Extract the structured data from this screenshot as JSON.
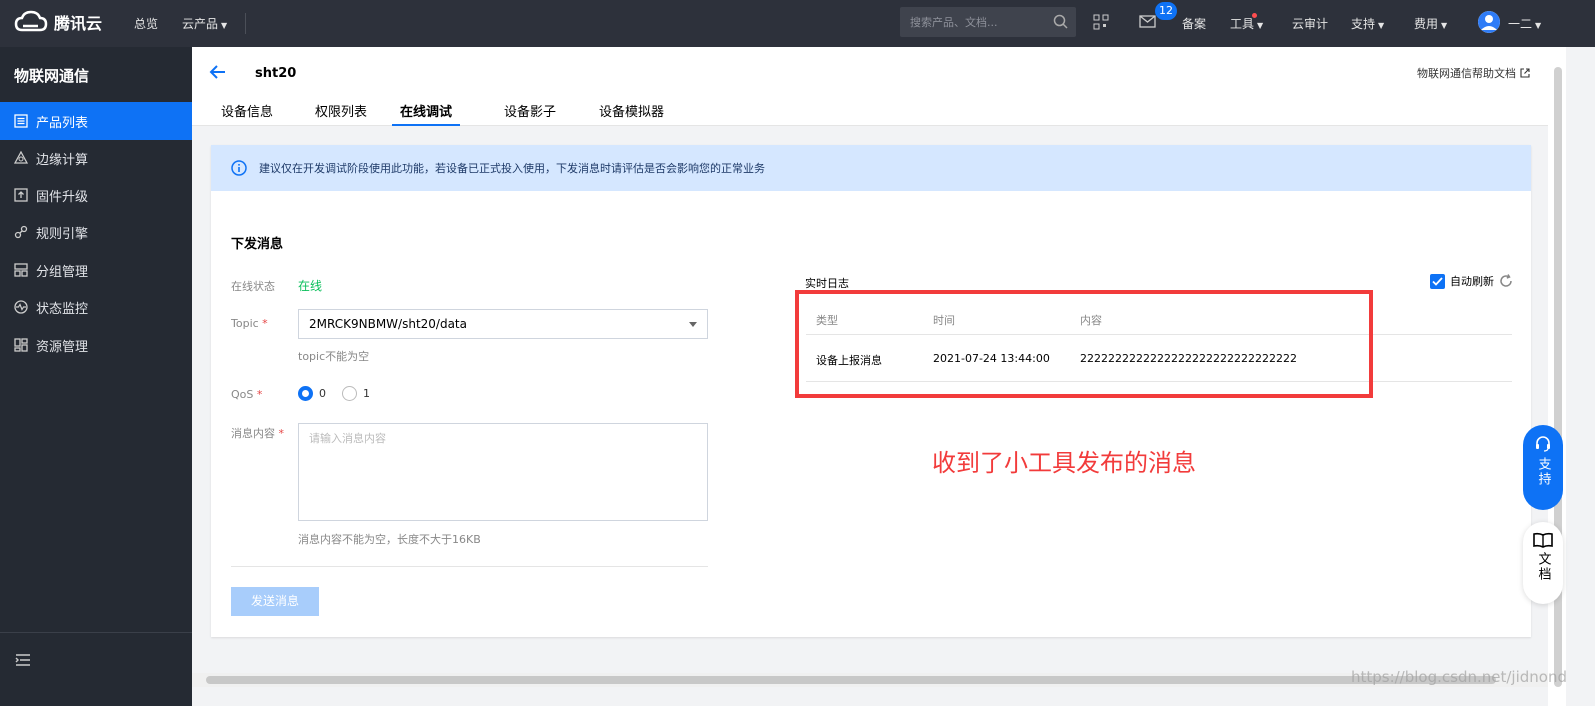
{
  "topbar": {
    "logo_text": "腾讯云",
    "nav_overview": "总览",
    "nav_products": "云产品",
    "search_placeholder": "搜索产品、文档...",
    "mail_badge": "12",
    "beian": "备案",
    "tools": "工具",
    "audit": "云审计",
    "support": "支持",
    "billing": "费用",
    "user": "一二"
  },
  "sidebar": {
    "title": "物联网通信",
    "items": [
      {
        "label": "产品列表",
        "icon": "list-icon"
      },
      {
        "label": "边缘计算",
        "icon": "edge-icon"
      },
      {
        "label": "固件升级",
        "icon": "upgrade-icon"
      },
      {
        "label": "规则引擎",
        "icon": "link-icon"
      },
      {
        "label": "分组管理",
        "icon": "group-icon"
      },
      {
        "label": "状态监控",
        "icon": "monitor-icon"
      },
      {
        "label": "资源管理",
        "icon": "resource-icon"
      }
    ]
  },
  "header": {
    "title": "sht20",
    "help_link": "物联网通信帮助文档",
    "tabs": [
      "设备信息",
      "权限列表",
      "在线调试",
      "设备影子",
      "设备模拟器"
    ],
    "active_tab": "在线调试"
  },
  "notice": "建议仅在开发调试阶段使用此功能，若设备已正式投入使用，下发消息时请评估是否会影响您的正常业务",
  "form": {
    "section_title": "下发消息",
    "status_label": "在线状态",
    "status_value": "在线",
    "topic_label": "Topic",
    "topic_value": "2MRCK9NBMW/sht20/data",
    "topic_hint": "topic不能为空",
    "qos_label": "QoS",
    "qos_options": [
      "0",
      "1"
    ],
    "qos_selected": "0",
    "content_label": "消息内容",
    "content_placeholder": "请输入消息内容",
    "content_hint": "消息内容不能为空，长度不大于16KB",
    "send_button": "发送消息",
    "required_mark": "*"
  },
  "log": {
    "title": "实时日志",
    "auto_refresh": "自动刷新",
    "auto_refresh_checked": true,
    "columns": [
      "类型",
      "时间",
      "内容"
    ],
    "rows": [
      {
        "type": "设备上报消息",
        "time": "2021-07-24 13:44:00",
        "content": "2222222222222222222222222222222"
      }
    ]
  },
  "annotation": "收到了小工具发布的消息",
  "float_buttons": {
    "support": "支持",
    "docs": "文档"
  },
  "watermark": "https://blog.csdn.net/jidnond",
  "colors": {
    "accent": "#0e72f5",
    "online": "#0abf5b",
    "annotation": "#f23b3b",
    "topbar": "#2d313b",
    "sidebar": "#252a33"
  }
}
